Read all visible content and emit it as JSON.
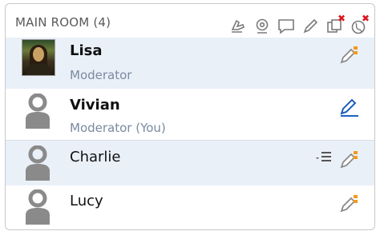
{
  "room": {
    "title": "MAIN ROOM (4)"
  },
  "toolbar": {
    "icons": [
      {
        "name": "raise-hand-icon"
      },
      {
        "name": "webcam-icon"
      },
      {
        "name": "chat-bubble-icon"
      },
      {
        "name": "pencil-icon"
      },
      {
        "name": "copy-disabled-icon"
      },
      {
        "name": "globe-disabled-icon"
      }
    ]
  },
  "participants": [
    {
      "name": "Lisa",
      "role": "Moderator",
      "avatar": "photo",
      "bold": true,
      "selected": true,
      "edit_icon": "pencil-orange-icon"
    },
    {
      "name": "Vivian",
      "role": "Moderator (You)",
      "avatar": "silhouette",
      "bold": true,
      "selected": false,
      "edit_icon": "pencil-blue-icon"
    },
    {
      "name": "Charlie",
      "role": "",
      "avatar": "silhouette",
      "bold": false,
      "selected": true,
      "edit_icon": "pencil-orange-icon",
      "has_menu": true
    },
    {
      "name": "Lucy",
      "role": "",
      "avatar": "silhouette",
      "bold": false,
      "selected": false,
      "edit_icon": "pencil-orange-icon"
    }
  ],
  "colors": {
    "selected_row": "#eaf0f8",
    "role_text": "#7a8aa0",
    "accent_orange": "#f39a1e",
    "accent_blue": "#1d5fbf",
    "disabled_red": "#d8181f"
  }
}
